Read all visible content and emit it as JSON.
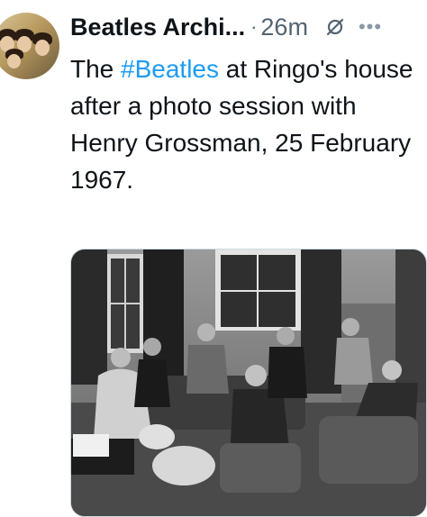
{
  "post": {
    "author_name": "Beatles Archi...",
    "separator": "·",
    "timestamp": "26m",
    "text_before": "The ",
    "hashtag": "#Beatles",
    "text_after": " at Ringo's house after a photo session with Henry Grossman, 25 February 1967.",
    "icons": {
      "avatar": "avatar-photo",
      "grok": "grok-slash-icon",
      "more": "more-dots-icon"
    },
    "colors": {
      "hashtag": "#1d9bf0",
      "meta": "#536471",
      "text": "#0f1419"
    }
  }
}
